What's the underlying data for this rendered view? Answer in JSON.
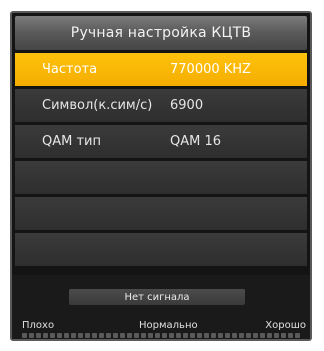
{
  "dialog": {
    "title": "Ручная настройка КЦТВ"
  },
  "menu": {
    "rows": [
      {
        "label": "Частота",
        "value": "770000 KHZ",
        "selected": true
      },
      {
        "label": "Символ(к.сим/с)",
        "value": "6900",
        "selected": false
      },
      {
        "label": "QAM тип",
        "value": "QAM 16",
        "selected": false
      },
      {
        "label": "",
        "value": "",
        "selected": false
      },
      {
        "label": "",
        "value": "",
        "selected": false
      },
      {
        "label": "",
        "value": "",
        "selected": false
      }
    ]
  },
  "signal": {
    "status": "Нет сигнала",
    "scale_poor": "Плохо",
    "scale_normal": "Нормально",
    "scale_good": "Хорошо",
    "level": 0
  },
  "colors": {
    "highlight": "#f9b800",
    "background": "#141414",
    "row": "#353535"
  }
}
